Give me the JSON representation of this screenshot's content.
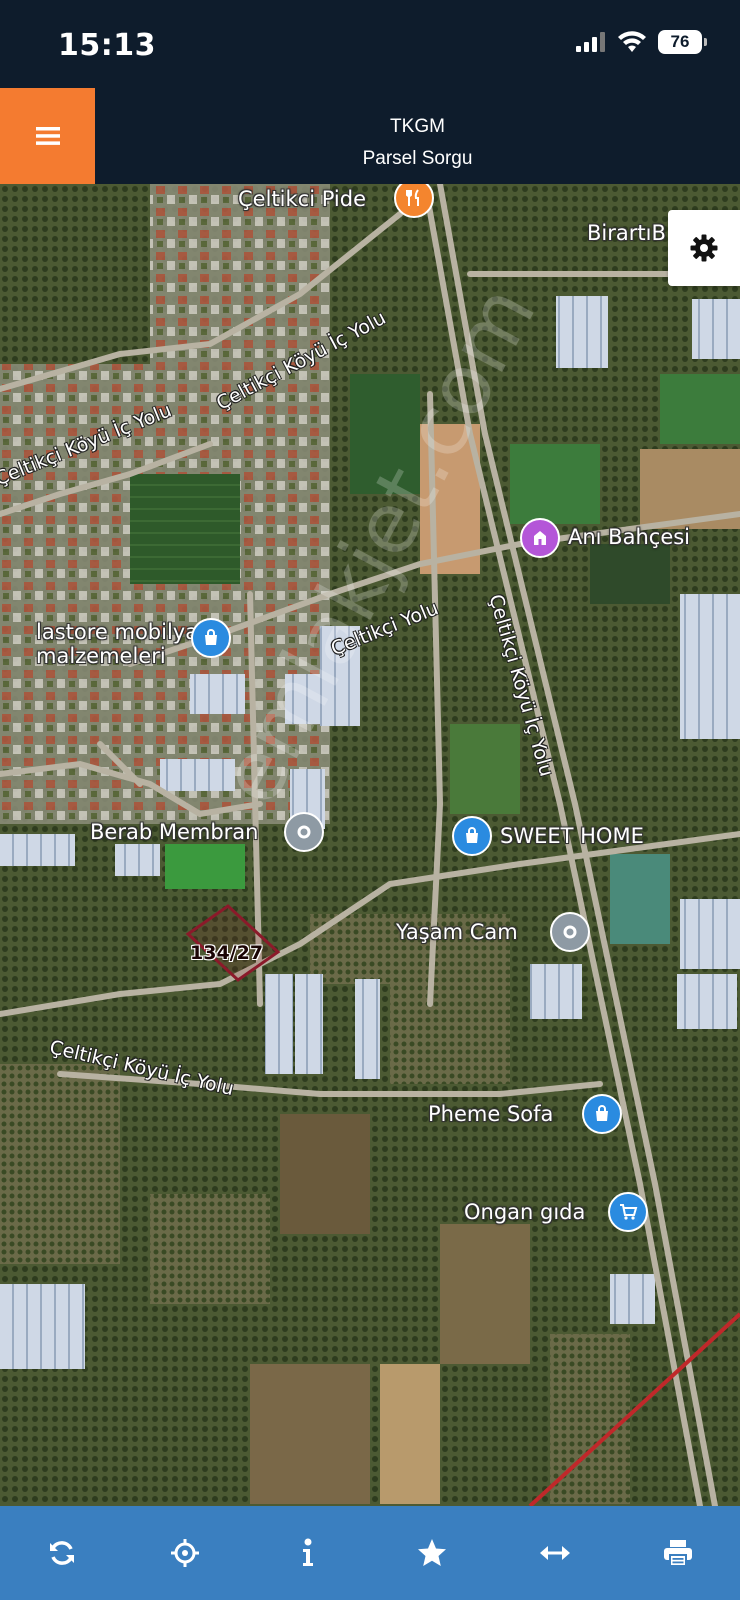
{
  "status_bar": {
    "time": "15:13",
    "battery": "76"
  },
  "header": {
    "title": "TKGM",
    "subtitle": "Parsel Sorgu"
  },
  "map": {
    "places": [
      {
        "name": "Çeltikci Pide",
        "type": "restaurant-icon"
      },
      {
        "name": "BirartıB",
        "type": "place"
      },
      {
        "name": "Anı Bahçesi",
        "type": "landmark-icon"
      },
      {
        "name": "lastore mobilya\nmalzemeleri",
        "type": "shop-icon"
      },
      {
        "name": "Berab Membran",
        "type": "place-icon"
      },
      {
        "name": "SWEET HOME",
        "type": "shop-icon"
      },
      {
        "name": "Yaşam Cam",
        "type": "place-icon"
      },
      {
        "name": "Pheme Sofa",
        "type": "shop-icon"
      },
      {
        "name": "Ongan gıda",
        "type": "cart-icon"
      }
    ],
    "roads": [
      "Çeltikçi Köyü İç Yolu",
      "Çeltikçi Köyü İç Yolu",
      "Çeltikçi Yolu",
      "Çeltikçi Köyü İç Yolu",
      "Çeltikçi Köyü İç Yolu"
    ],
    "parcel": {
      "label": "134/27"
    },
    "watermark": "emlakjet.com"
  },
  "toolbar": {
    "buttons": [
      "refresh-icon",
      "locate-icon",
      "info-icon",
      "star-icon",
      "measure-icon",
      "print-icon"
    ]
  },
  "colors": {
    "header": "#0e1c2c",
    "menu_button": "#f47b30",
    "toolbar": "#3a7fc0",
    "parcel_outline": "#8b1a2a",
    "boundary_line": "#c0282a"
  }
}
